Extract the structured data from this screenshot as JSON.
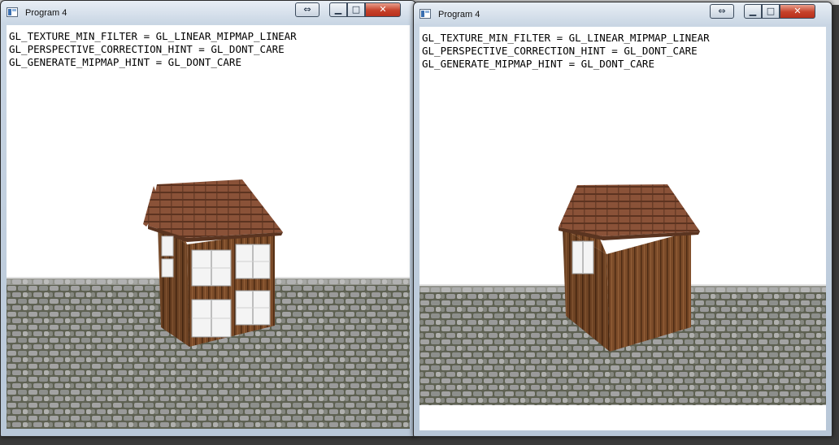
{
  "windows": [
    {
      "title": "Program 4",
      "controls": {
        "extend": "⇔",
        "minimize": "▁",
        "maximize": "□",
        "close": "✕"
      },
      "gl_info": [
        "GL_TEXTURE_MIN_FILTER = GL_LINEAR_MIPMAP_LINEAR",
        "GL_PERSPECTIVE_CORRECTION_HINT = GL_DONT_CARE",
        "GL_GENERATE_MIPMAP_HINT = GL_DONT_CARE"
      ]
    },
    {
      "title": "Program 4",
      "controls": {
        "extend": "⇔",
        "minimize": "▁",
        "maximize": "□",
        "close": "✕"
      },
      "gl_info": [
        "GL_TEXTURE_MIN_FILTER = GL_LINEAR_MIPMAP_LINEAR",
        "GL_PERSPECTIVE_CORRECTION_HINT = GL_DONT_CARE",
        "GL_GENERATE_MIPMAP_HINT = GL_DONT_CARE"
      ]
    }
  ],
  "colors": {
    "clear_color": "#ffffff",
    "cobblestone_light": "#9a9a9a",
    "cobblestone_dark": "#5e6152",
    "wood": "#7a4a28",
    "roof": "#8a5238",
    "window_frame": "#f2f2f2"
  },
  "icons": [
    "app-window-icon",
    "extend-frame-icon",
    "minimize-icon",
    "maximize-icon",
    "close-icon"
  ]
}
